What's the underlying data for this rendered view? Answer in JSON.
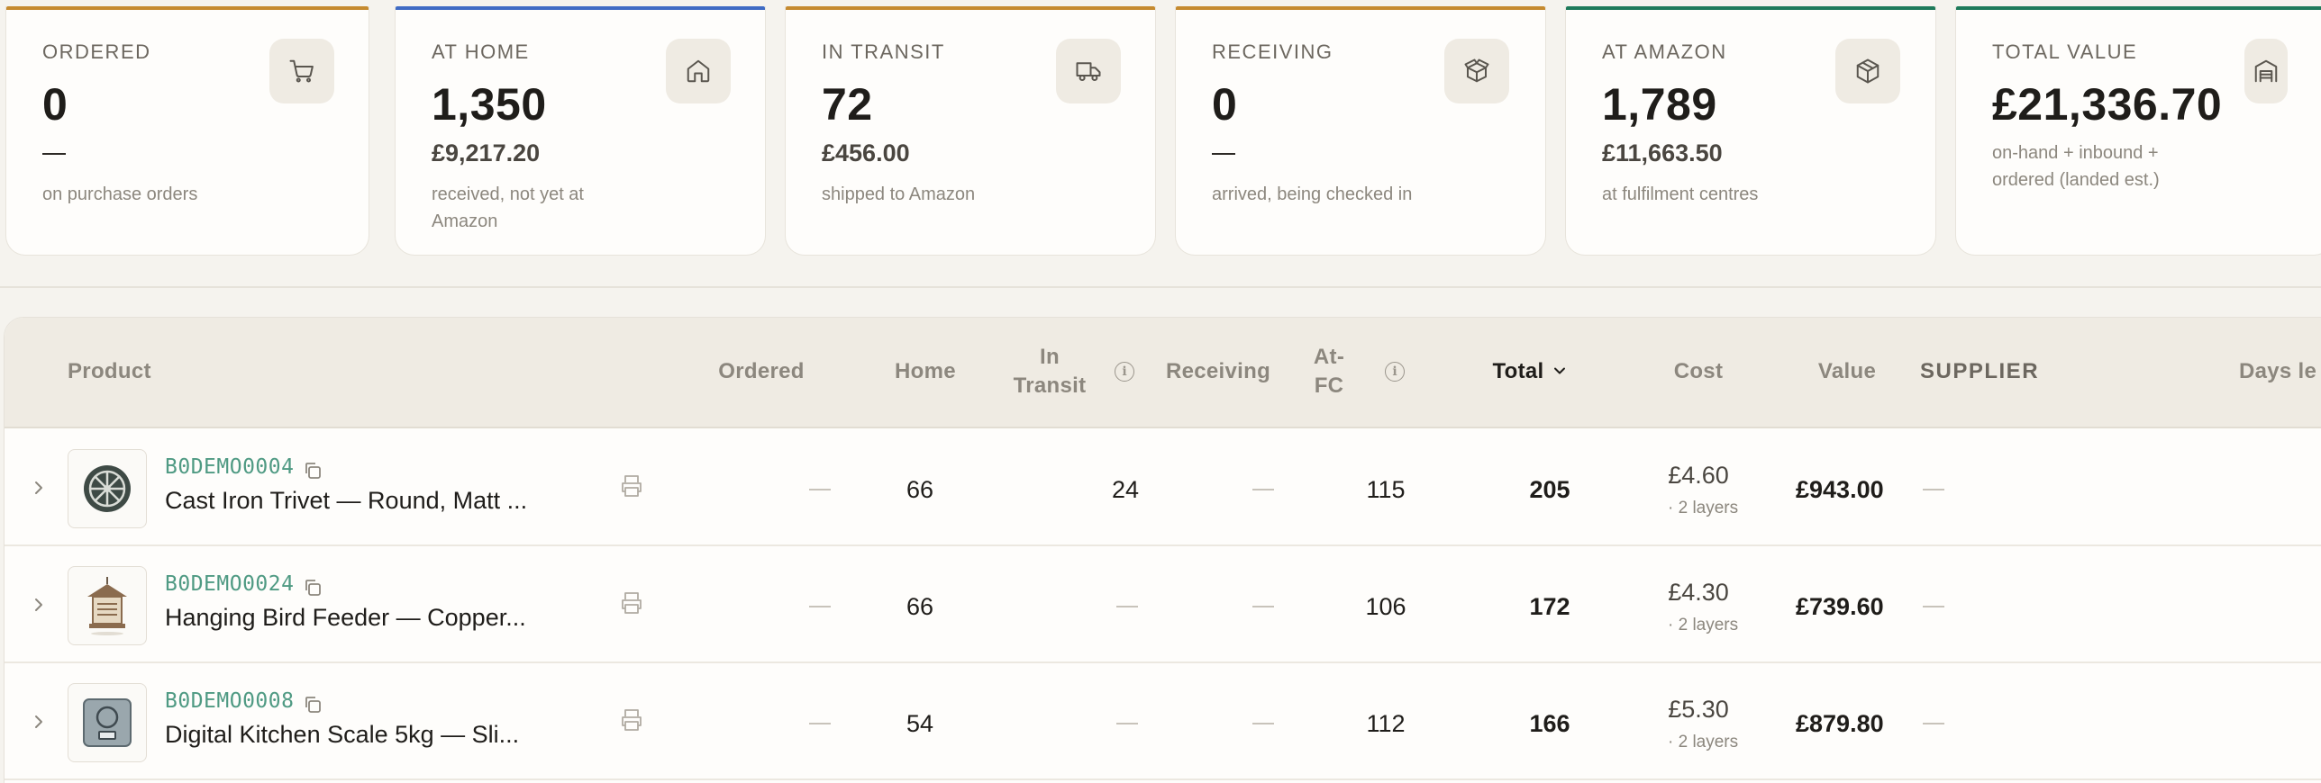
{
  "cards": [
    {
      "label": "ORDERED",
      "value": "0",
      "sub": "",
      "desc": "on purchase orders",
      "icon": "cart-icon",
      "accent": "#c58a2f"
    },
    {
      "label": "AT HOME",
      "value": "1,350",
      "sub": "£9,217.20",
      "desc": "received, not yet at Amazon",
      "icon": "home-icon",
      "accent": "#3f6bc4"
    },
    {
      "label": "IN TRANSIT",
      "value": "72",
      "sub": "£456.00",
      "desc": "shipped to Amazon",
      "icon": "truck-icon",
      "accent": "#c58a2f"
    },
    {
      "label": "RECEIVING",
      "value": "0",
      "sub": "",
      "desc": "arrived, being checked in",
      "icon": "package-open-icon",
      "accent": "#c58a2f"
    },
    {
      "label": "AT AMAZON",
      "value": "1,789",
      "sub": "£11,663.50",
      "desc": "at fulfilment centres",
      "icon": "box-icon",
      "accent": "#1e7a5a"
    },
    {
      "label": "TOTAL VALUE",
      "value": "£21,336.70",
      "sub": "",
      "desc": "on-hand + inbound + ordered (landed est.)",
      "icon": "warehouse-icon",
      "accent": "#1e7a5a"
    }
  ],
  "table": {
    "headers": {
      "product": "Product",
      "ordered": "Ordered",
      "home": "Home",
      "in_transit_1": "In",
      "in_transit_2": "Transit",
      "receiving": "Receiving",
      "at_fc_1": "At-",
      "at_fc_2": "FC",
      "total": "Total",
      "cost": "Cost",
      "value": "Value",
      "supplier": "SUPPLIER",
      "days_left": "Days le"
    },
    "rows": [
      {
        "sku": "B0DEMO0004",
        "name": "Cast Iron Trivet — Round, Matt ...",
        "ordered": "—",
        "home": "66",
        "in_transit": "24",
        "receiving": "—",
        "at_fc": "115",
        "total": "205",
        "cost": "£4.60",
        "layers": "· 2 layers",
        "value": "£943.00",
        "supplier": "—",
        "thumb": "trivet"
      },
      {
        "sku": "B0DEMO0024",
        "name": "Hanging Bird Feeder — Copper...",
        "ordered": "—",
        "home": "66",
        "in_transit": "—",
        "receiving": "—",
        "at_fc": "106",
        "total": "172",
        "cost": "£4.30",
        "layers": "· 2 layers",
        "value": "£739.60",
        "supplier": "—",
        "thumb": "feeder"
      },
      {
        "sku": "B0DEMO0008",
        "name": "Digital Kitchen Scale 5kg — Sli...",
        "ordered": "—",
        "home": "54",
        "in_transit": "—",
        "receiving": "—",
        "at_fc": "112",
        "total": "166",
        "cost": "£5.30",
        "layers": "· 2 layers",
        "value": "£879.80",
        "supplier": "—",
        "thumb": "scale"
      }
    ]
  }
}
